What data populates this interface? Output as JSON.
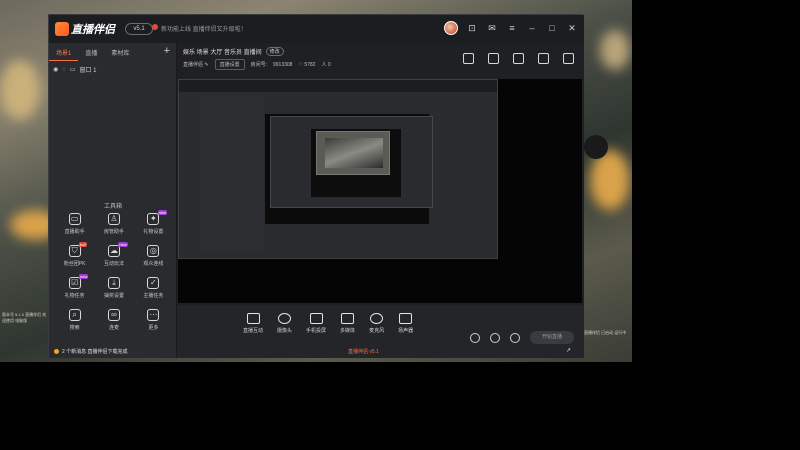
{
  "app": {
    "logo_text": "直播伴侣",
    "version": "v5.1",
    "notice": "新功能上线 直播伴侣又升级啦！",
    "window_controls": [
      "minimize",
      "maximize",
      "close"
    ]
  },
  "left_panel": {
    "tabs": [
      "场景1",
      "直播",
      "素材库"
    ],
    "active_tab": 0,
    "scene_item": "窗口 1",
    "toolbox_title": "工具箱",
    "tools": [
      {
        "label": "直播助手",
        "icon": "chat-icon",
        "tag": ""
      },
      {
        "label": "房管助手",
        "icon": "person-icon",
        "tag": ""
      },
      {
        "label": "礼物设置",
        "icon": "gift-icon",
        "tag": "new"
      },
      {
        "label": "粉丝团PK",
        "icon": "shield-icon",
        "tag": "hot"
      },
      {
        "label": "互动玩法",
        "icon": "cloud-icon",
        "tag": "new"
      },
      {
        "label": "观众连线",
        "icon": "target-icon",
        "tag": ""
      },
      {
        "label": "礼物任务",
        "icon": "task-icon",
        "tag": "new"
      },
      {
        "label": "抽奖设置",
        "icon": "download-icon",
        "tag": ""
      },
      {
        "label": "主播任务",
        "icon": "check-icon",
        "tag": ""
      },
      {
        "label": "搜索",
        "icon": "search-icon",
        "tag": ""
      },
      {
        "label": "连麦",
        "icon": "link-icon",
        "tag": ""
      },
      {
        "label": "更多",
        "icon": "more-icon",
        "tag": ""
      }
    ]
  },
  "main": {
    "room_title": "娱乐 场景 大厅 音乐员 直播间",
    "room_badge": "修改",
    "room_owner": "直播伴侣 ✎",
    "room_btn": "直播设置",
    "room_id_label": "房间号:",
    "room_id": "9913308",
    "fans_label": "♡ 5782",
    "viewers_label": "人 0",
    "top_icons": [
      "layout-icon",
      "lock-icon",
      "record-icon",
      "screenshot-icon",
      "share-icon"
    ]
  },
  "bottom": {
    "items": [
      {
        "label": "直播互动",
        "icon": "chat-icon"
      },
      {
        "label": "摄像头",
        "icon": "camera-icon"
      },
      {
        "label": "手机投屏",
        "icon": "phone-icon"
      },
      {
        "label": "多媒体",
        "icon": "play-icon"
      },
      {
        "label": "麦克风",
        "icon": "mic-icon"
      },
      {
        "label": "扬声器",
        "icon": "speaker-icon"
      }
    ],
    "start_label": "开始直播",
    "right_icons": [
      "video-icon",
      "audio-icon",
      "settings-icon"
    ],
    "status_text": "直播伴侣 | 直播预览窗口"
  },
  "taskbar": {
    "notification": "2 个新消息 直播伴侣下载完成",
    "center_text": "直播伴侣 v5.1",
    "arrow": "↗"
  },
  "desktop": {
    "text_left": "版本号 5.1.0 直播伴侣 欢迎使用 电脑版",
    "text_right": "直播伴侣 已启动 运行中"
  }
}
